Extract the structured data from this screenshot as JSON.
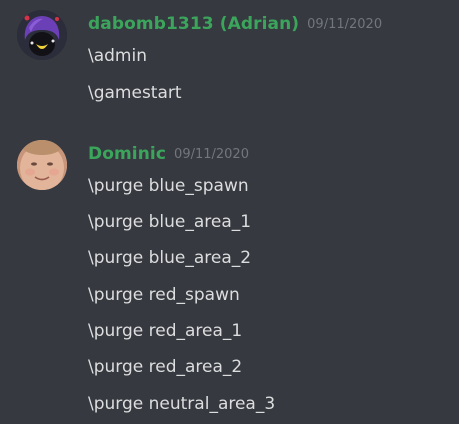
{
  "colors": {
    "background": "#36393f",
    "username": "#3ba55c",
    "timestamp": "#72767d",
    "message_text": "#dcddde"
  },
  "groups": [
    {
      "avatar_icon": "purple-haired-cartoon-avatar-icon",
      "username": "dabomb1313 (Adrian)",
      "timestamp": "09/11/2020",
      "messages": [
        "\\admin",
        "\\gamestart"
      ]
    },
    {
      "avatar_icon": "face-photo-avatar-icon",
      "username": "Dominic",
      "timestamp": "09/11/2020",
      "messages": [
        "\\purge blue_spawn",
        "\\purge blue_area_1",
        "\\purge blue_area_2",
        "\\purge red_spawn",
        "\\purge red_area_1",
        "\\purge red_area_2",
        "\\purge neutral_area_3"
      ]
    }
  ]
}
